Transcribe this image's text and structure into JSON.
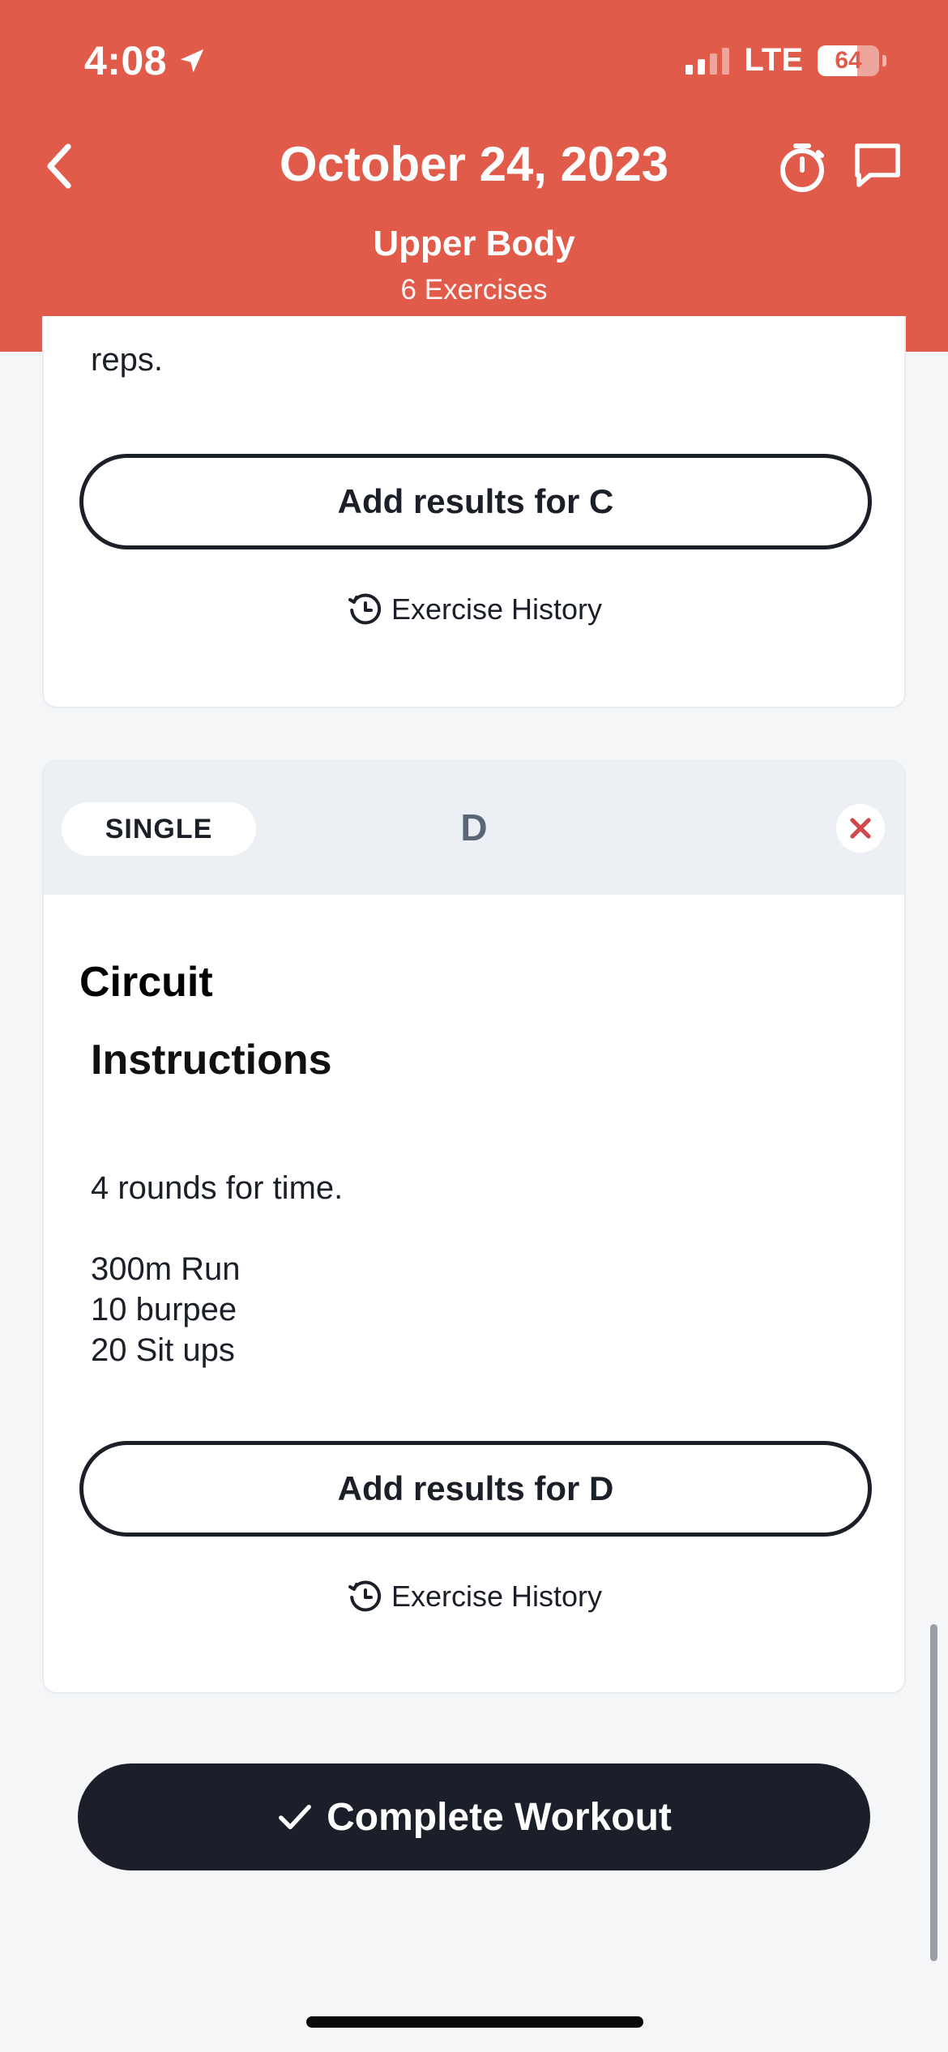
{
  "status_bar": {
    "time": "4:08",
    "carrier": "LTE",
    "battery": "64",
    "battery_level": 0.64
  },
  "header": {
    "title": "October 24, 2023",
    "subtitle": "Upper Body",
    "exercise_count": "6 Exercises",
    "icons": [
      "chevron-left-icon",
      "stopwatch-icon",
      "chat-icon"
    ],
    "background_color": "#e15b4b"
  },
  "block_c": {
    "trailing_text": "reps.",
    "results_button": "Add results for C",
    "history_link": "Exercise History"
  },
  "block_d": {
    "type_badge": "SINGLE",
    "letter": "D",
    "exercise_name": "Circuit",
    "instructions_title": "Instructions",
    "instructions": [
      "4 rounds for time.",
      "300m Run",
      "10 burpee",
      "20 Sit ups"
    ],
    "results_button": "Add results for D",
    "history_link": "Exercise History"
  },
  "footer": {
    "complete_button": "Complete Workout"
  },
  "colors": {
    "accent_red": "#e15b4b",
    "dark_button": "#1b1f2a",
    "remove_x": "#d2474b"
  }
}
